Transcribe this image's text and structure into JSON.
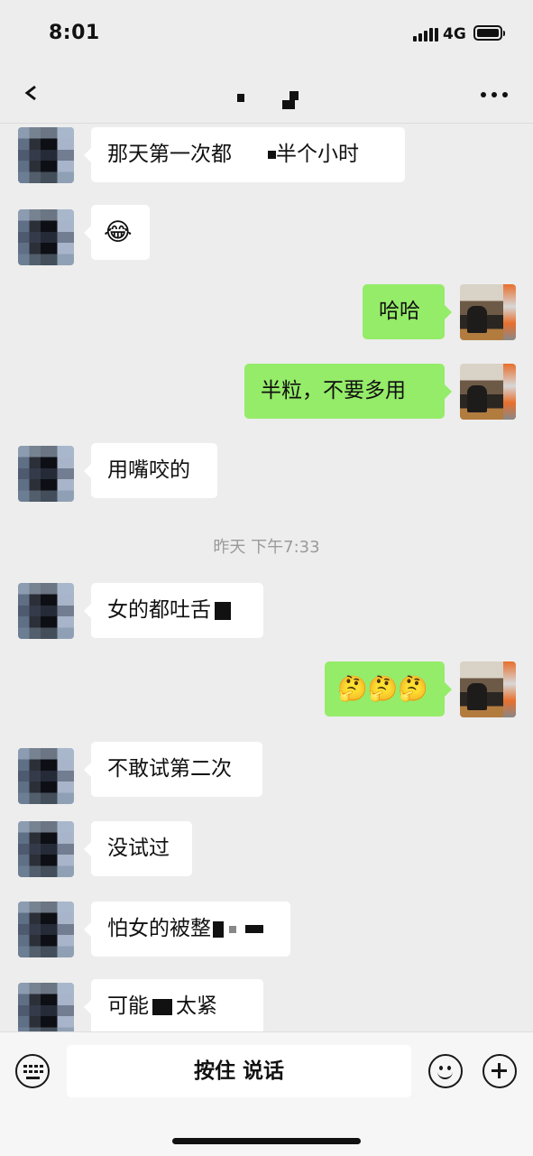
{
  "status_bar": {
    "time": "8:01",
    "network": "4G",
    "icons": [
      "signal-icon",
      "battery-icon"
    ]
  },
  "nav": {
    "back_icon": "back-chevron-icon",
    "title": "",
    "more_icon": "more-dots-icon"
  },
  "messages": [
    {
      "side": "in",
      "parts": [
        "那天第一次都",
        "半个小时"
      ]
    },
    {
      "side": "in",
      "emoji": "😂"
    },
    {
      "side": "out",
      "text": "哈哈"
    },
    {
      "side": "out",
      "text": "半粒，不要多用"
    },
    {
      "side": "in",
      "text": "用嘴咬的"
    },
    {
      "side": "in",
      "text": "女的都吐舌"
    },
    {
      "side": "out",
      "emoji": "🤔🤔🤔"
    },
    {
      "side": "in",
      "text": "不敢试第二次"
    },
    {
      "side": "in",
      "text": "没试过"
    },
    {
      "side": "in",
      "text": "怕女的被整"
    },
    {
      "side": "in",
      "parts": [
        "可能",
        "太紧"
      ]
    }
  ],
  "timestamp": "昨天 下午7:33",
  "input_bar": {
    "keyboard_icon": "keyboard-icon",
    "hold_to_talk": "按住 说话",
    "emoji_icon": "smiley-icon",
    "add_icon": "plus-icon"
  },
  "colors": {
    "background": "#ededed",
    "incoming_bubble": "#ffffff",
    "outgoing_bubble": "#95ec69",
    "timestamp_text": "#9a9a9a"
  }
}
